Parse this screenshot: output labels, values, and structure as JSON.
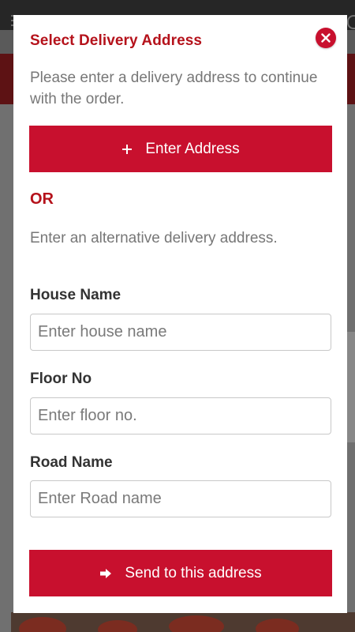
{
  "modal": {
    "title": "Select Delivery Address",
    "intro": "Please enter a delivery address to continue with the order.",
    "enter_address_button": {
      "label": "Enter Address",
      "icon": "plus-icon"
    },
    "or_label": "OR",
    "alternative_text": "Enter an alternative delivery address.",
    "fields": {
      "house_name": {
        "label": "House Name",
        "placeholder": "Enter house name",
        "value": ""
      },
      "floor_no": {
        "label": "Floor No",
        "placeholder": "Enter floor no.",
        "value": ""
      },
      "road_name": {
        "label": "Road Name",
        "placeholder": "Enter Road name",
        "value": ""
      }
    },
    "send_button": {
      "label": "Send to this address",
      "icon": "arrow-right-icon"
    },
    "close_icon": "close-icon"
  },
  "colors": {
    "accent": "#c8102e",
    "title": "#b5121b",
    "muted_text": "#777777",
    "label_text": "#333333"
  }
}
